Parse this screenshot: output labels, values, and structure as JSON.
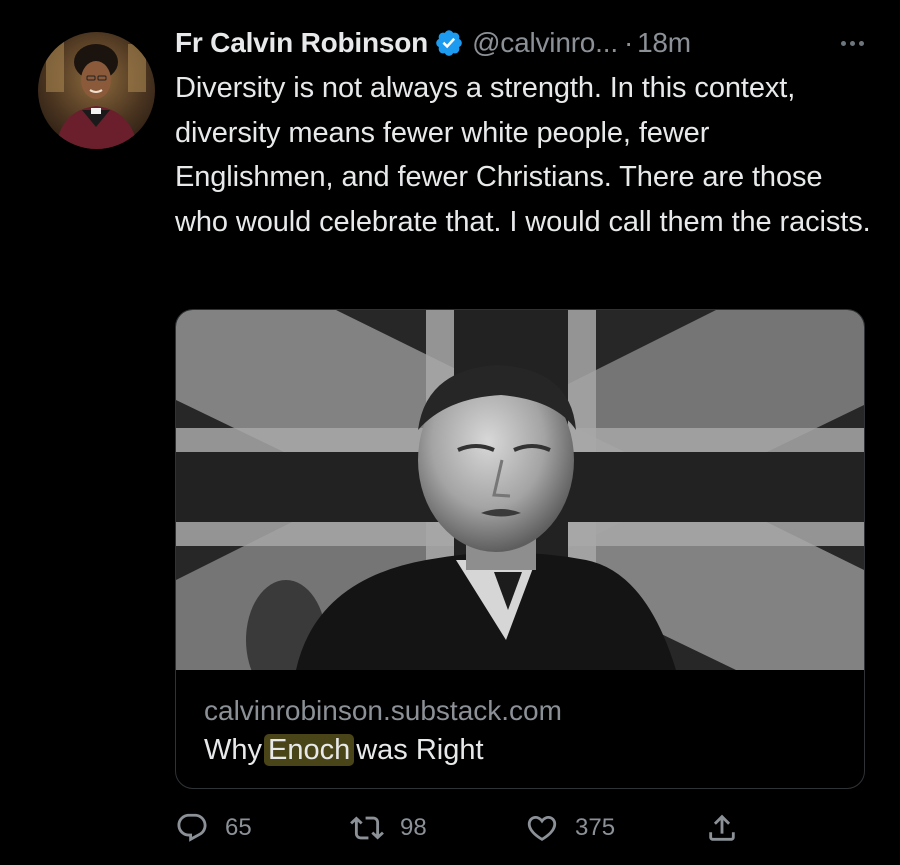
{
  "tweet": {
    "author": {
      "display_name": "Fr Calvin Robinson",
      "handle": "@calvinro...",
      "verified": true,
      "avatar_icon": "profile-photo"
    },
    "separator": "·",
    "timestamp": "18m",
    "text": "Diversity is not always a strength. In this context, diversity means fewer white people, fewer Englishmen, and fewer Christians. There are those who would celebrate that. I would call them the racists.",
    "card": {
      "image_icon": "black-and-white-portrait-with-union-flag",
      "domain": "calvinrobinson.substack.com",
      "title_before": "Why",
      "title_highlight": "Enoch",
      "title_after": "was Right"
    },
    "actions": {
      "replies": "65",
      "retweets": "98",
      "likes": "375"
    }
  },
  "colors": {
    "background": "#000000",
    "primary_text": "#e7e9ea",
    "secondary_text": "#8b9197",
    "verified_badge": "#1d9bf0",
    "card_border": "#2f3336",
    "highlight": "#4a4518"
  }
}
